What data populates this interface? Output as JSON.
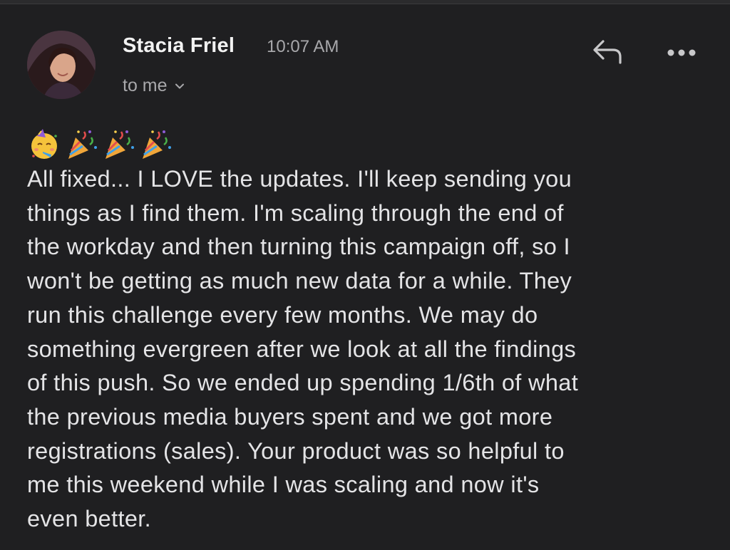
{
  "header": {
    "sender_name": "Stacia Friel",
    "time": "10:07 AM",
    "recipient_label": "to me"
  },
  "icons": {
    "avatar": "avatar",
    "reply": "reply-icon",
    "more": "more-options-icon",
    "chevron": "chevron-down-icon",
    "emojis": [
      "partying-face-emoji",
      "party-popper-emoji",
      "party-popper-emoji",
      "party-popper-emoji"
    ]
  },
  "message": {
    "body": "All fixed... I LOVE the updates. I'll keep sending you\nthings as I find them. I'm scaling through the end of\nthe workday and then turning this campaign off, so I\nwon't be getting as much new data for a while. They\nrun this challenge every few months. We may do\nsomething evergreen after we look at all the findings\nof this push. So we ended up spending 1/6th of what\nthe previous media buyers spent and we got more\nregistrations (sales). Your product was so helpful to\nme this weekend while I was scaling and now it's\neven better."
  },
  "colors": {
    "background": "#1f1f21",
    "text_primary": "#e4e4e6",
    "text_secondary": "#a8a8ab"
  }
}
